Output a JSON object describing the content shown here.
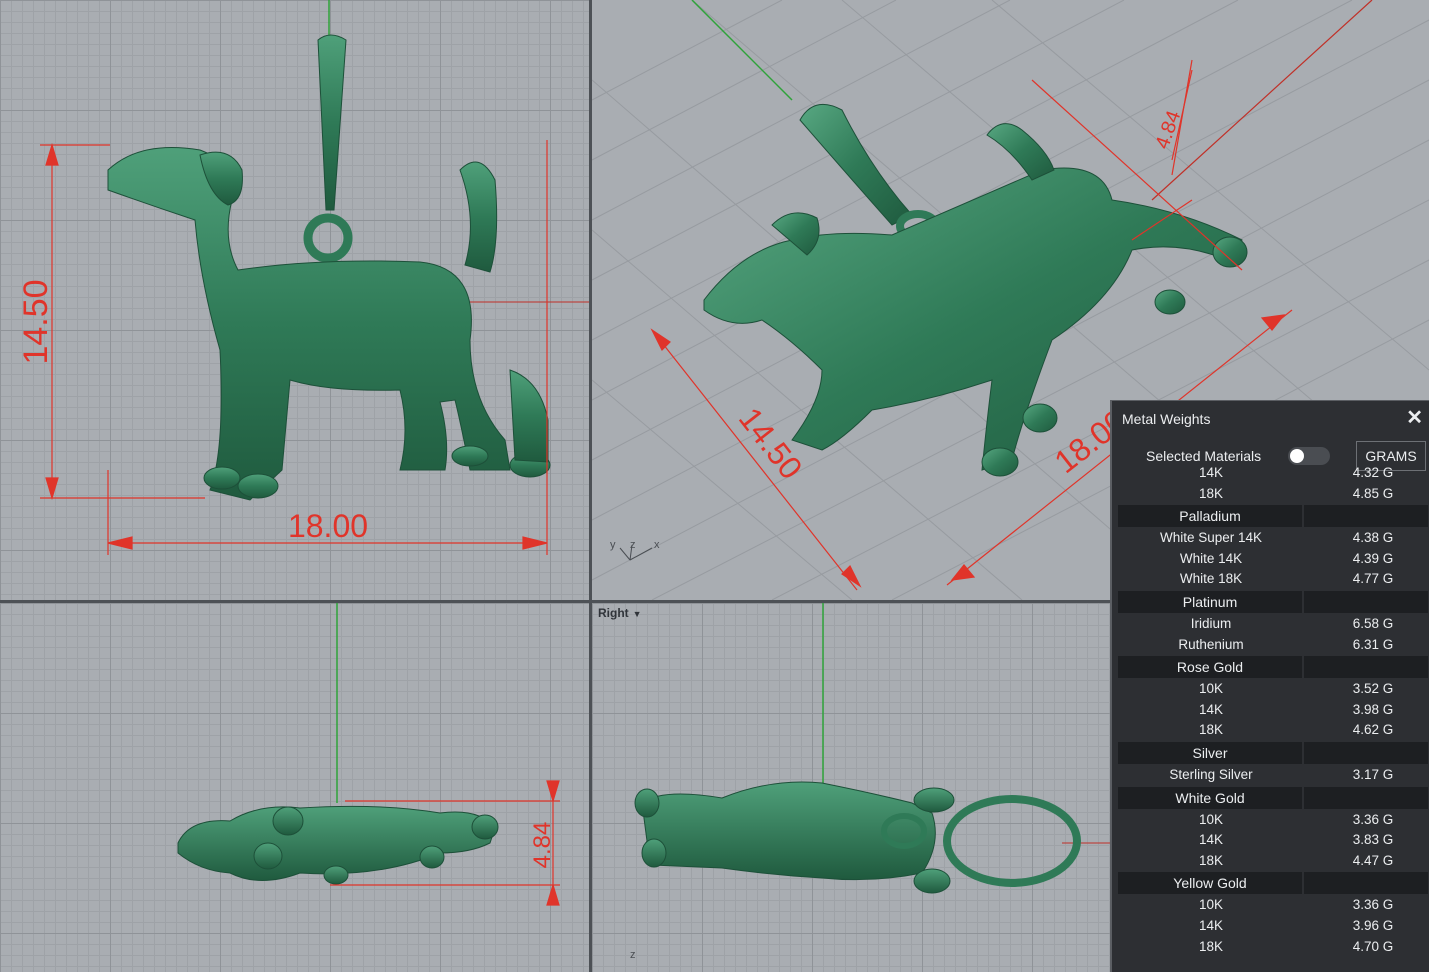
{
  "viewports": {
    "right_label": "Right",
    "front_dims": {
      "height": "14.50",
      "width": "18.00"
    },
    "persp_dims": {
      "height": "14.50",
      "depth": "4.84",
      "width": "18.00"
    },
    "top_dims": {
      "depth": "4.84"
    },
    "axis_labels": {
      "x": "x",
      "y": "y",
      "z": "z"
    }
  },
  "panel": {
    "title": "Metal Weights",
    "close_icon": "close-icon",
    "selected_label": "Selected Materials",
    "unit_button": "GRAMS",
    "partial_rows": [
      {
        "name": "14K",
        "value": "4.32 G"
      },
      {
        "name": "18K",
        "value": "4.85 G"
      }
    ],
    "groups": [
      {
        "name": "Palladium",
        "rows": [
          {
            "name": "White Super 14K",
            "value": "4.38 G"
          },
          {
            "name": "White 14K",
            "value": "4.39 G"
          },
          {
            "name": "White 18K",
            "value": "4.77 G"
          }
        ]
      },
      {
        "name": "Platinum",
        "rows": [
          {
            "name": "Iridium",
            "value": "6.58 G"
          },
          {
            "name": "Ruthenium",
            "value": "6.31 G"
          }
        ]
      },
      {
        "name": "Rose Gold",
        "rows": [
          {
            "name": "10K",
            "value": "3.52 G"
          },
          {
            "name": "14K",
            "value": "3.98 G"
          },
          {
            "name": "18K",
            "value": "4.62 G"
          }
        ]
      },
      {
        "name": "Silver",
        "rows": [
          {
            "name": "Sterling Silver",
            "value": "3.17 G"
          }
        ]
      },
      {
        "name": "White Gold",
        "rows": [
          {
            "name": "10K",
            "value": "3.36 G"
          },
          {
            "name": "14K",
            "value": "3.83 G"
          },
          {
            "name": "18K",
            "value": "4.47 G"
          }
        ]
      },
      {
        "name": "Yellow Gold",
        "rows": [
          {
            "name": "10K",
            "value": "3.36 G"
          },
          {
            "name": "14K",
            "value": "3.96 G"
          },
          {
            "name": "18K",
            "value": "4.70 G"
          }
        ]
      }
    ]
  },
  "colors": {
    "model": "#2f7a57",
    "dimension": "#e0342a",
    "axis_green": "#2fa33a"
  }
}
